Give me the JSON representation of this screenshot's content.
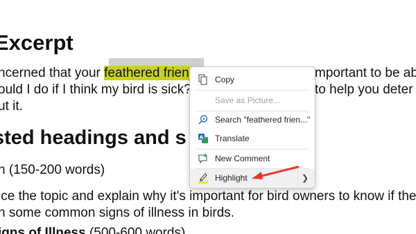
{
  "document": {
    "heading1": "Excerpt",
    "line1_before": "ncerned that your ",
    "line1_highlight": "feathered frien",
    "line1_after": "mportant to be ab",
    "line2_before": "ould I do if I think my bird is sick?",
    "line2_after": "to help you deter",
    "line3": "ut it.",
    "heading2": "sted headings and s",
    "line4": "n (150-200 words)",
    "line5": "ice the topic and explain why it's important for bird owners to know if the",
    "line6": "n some common signs of illness in birds.",
    "line7_bold": "igns of Illness",
    "line7_rest": " (500-600 words)"
  },
  "context_menu": {
    "items": [
      {
        "label": "Copy",
        "icon": "copy-icon",
        "disabled": false
      },
      {
        "label": "Save as Picture...",
        "icon": "save-picture-icon",
        "disabled": true
      },
      {
        "label": "Search \"feathered frien...\"",
        "icon": "search-icon",
        "disabled": false
      },
      {
        "label": "Translate",
        "icon": "translate-icon",
        "disabled": false
      },
      {
        "label": "New Comment",
        "icon": "new-comment-icon",
        "disabled": false
      },
      {
        "label": "Highlight",
        "icon": "highlighter-icon",
        "disabled": false,
        "has_submenu": true
      }
    ]
  },
  "colors": {
    "text_highlight": "#c8d320",
    "annotation_arrow": "#e8352e",
    "menu_border": "#c8c8c8"
  }
}
